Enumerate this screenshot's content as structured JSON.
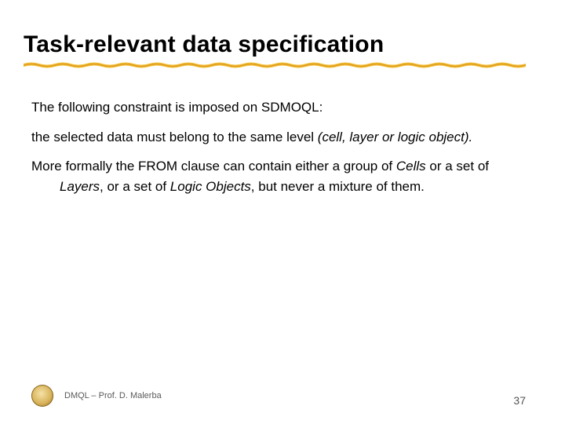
{
  "title": "Task-relevant data specification",
  "body": {
    "p1": "The following constraint is imposed on SDMOQL:",
    "p2_a": "the selected data must belong to the same level ",
    "p2_b": "(cell, layer or logic object).",
    "p3_a": "More formally the FROM clause can contain either a group of ",
    "p3_b": "Cells",
    "p3_c": " or a set of ",
    "p3_d": "Layers",
    "p3_e": ", or a set of ",
    "p3_f": "Logic Objects",
    "p3_g": ", but never a mixture of them."
  },
  "footer": {
    "text": "DMQL – Prof. D. Malerba",
    "page": "37"
  }
}
